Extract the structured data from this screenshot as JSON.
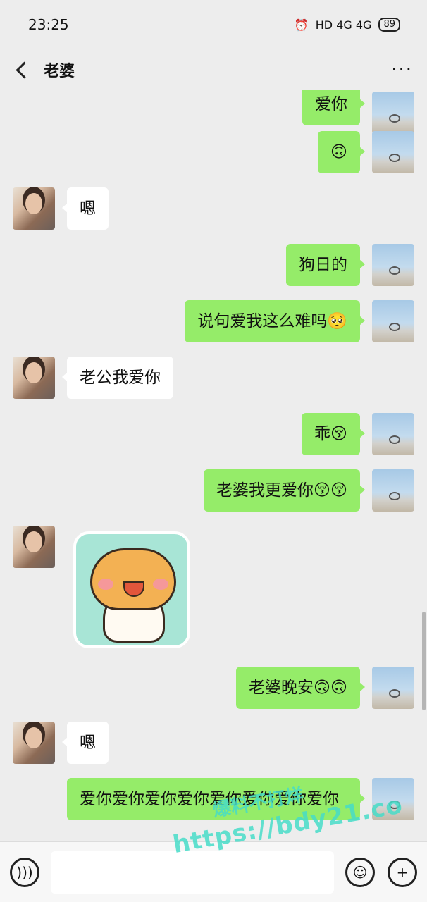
{
  "status_bar": {
    "time": "23:25",
    "network": "HD 4G 4G",
    "battery": "89"
  },
  "nav": {
    "title": "老婆",
    "more": "···"
  },
  "messages": [
    {
      "from": "self",
      "text": "爱你"
    },
    {
      "from": "self",
      "emoji": "🙃"
    },
    {
      "from": "wife",
      "text": "嗯"
    },
    {
      "from": "self",
      "text": "狗日的"
    },
    {
      "from": "self",
      "text": "说句爱我这么难吗",
      "emoji": "🥺"
    },
    {
      "from": "wife",
      "text": "老公我爱你"
    },
    {
      "from": "self",
      "text": "乖",
      "emoji": "😚"
    },
    {
      "from": "self",
      "text": "老婆我更爱你",
      "emoji": "😚😚"
    },
    {
      "from": "wife",
      "sticker": "hamster-sticker"
    },
    {
      "from": "self",
      "text": "老婆晚安",
      "emoji": "🙃🙃"
    },
    {
      "from": "wife",
      "text": "嗯"
    },
    {
      "from": "self",
      "text": "爱你爱你爱你爱你爱你爱你爱你爱你"
    }
  ],
  "input": {
    "placeholder": ""
  },
  "watermark": {
    "line1": "爆料不打烊",
    "line2": "https://bdy21.co"
  },
  "colors": {
    "self_bubble": "#95ec69",
    "wife_bubble": "#ffffff",
    "background": "#ededed"
  }
}
